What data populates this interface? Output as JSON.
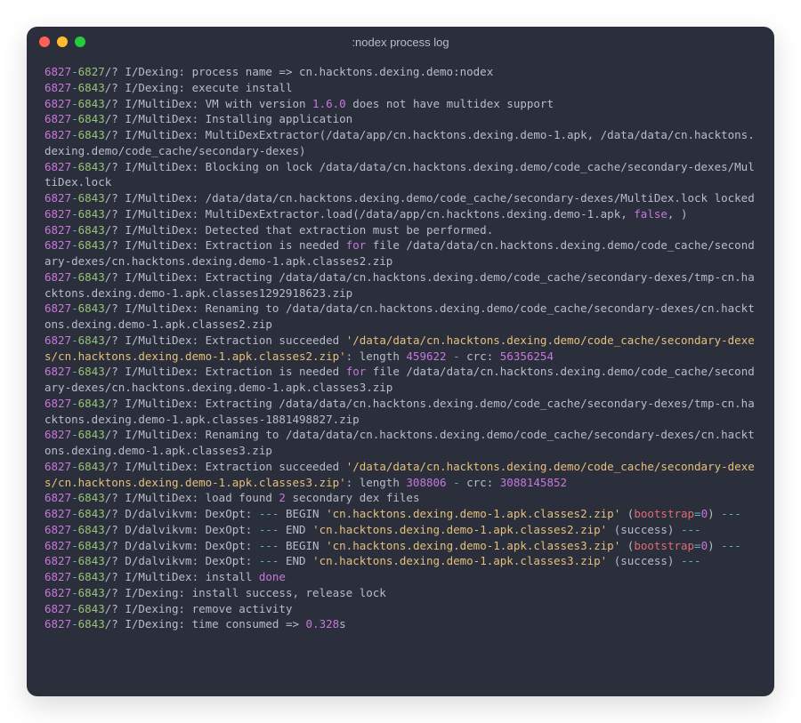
{
  "window": {
    "title": ":nodex process log"
  },
  "log": {
    "lines": [
      {
        "segments": [
          {
            "c": "magenta",
            "t": "6827"
          },
          {
            "c": "cyan",
            "t": "-"
          },
          {
            "c": "green",
            "t": "6827"
          },
          {
            "c": "gray",
            "t": "/? I/Dexing: process name => cn.hacktons.dexing.demo:nodex"
          }
        ]
      },
      {
        "segments": [
          {
            "c": "magenta",
            "t": "6827"
          },
          {
            "c": "cyan",
            "t": "-"
          },
          {
            "c": "green",
            "t": "6843"
          },
          {
            "c": "gray",
            "t": "/? I/Dexing: execute install"
          }
        ]
      },
      {
        "segments": [
          {
            "c": "magenta",
            "t": "6827"
          },
          {
            "c": "cyan",
            "t": "-"
          },
          {
            "c": "green",
            "t": "6843"
          },
          {
            "c": "gray",
            "t": "/? I/MultiDex: VM with version "
          },
          {
            "c": "magenta",
            "t": "1.6.0"
          },
          {
            "c": "gray",
            "t": " does not have multidex support"
          }
        ]
      },
      {
        "segments": [
          {
            "c": "magenta",
            "t": "6827"
          },
          {
            "c": "cyan",
            "t": "-"
          },
          {
            "c": "green",
            "t": "6843"
          },
          {
            "c": "gray",
            "t": "/? I/MultiDex: Installing application"
          }
        ]
      },
      {
        "segments": [
          {
            "c": "magenta",
            "t": "6827"
          },
          {
            "c": "cyan",
            "t": "-"
          },
          {
            "c": "green",
            "t": "6843"
          },
          {
            "c": "gray",
            "t": "/? I/MultiDex: MultiDexExtractor(/data/app/cn.hacktons.dexing.demo-1.apk, /data/data/cn.hacktons.dexing.demo/code_cache/secondary-dexes)"
          }
        ]
      },
      {
        "segments": [
          {
            "c": "magenta",
            "t": "6827"
          },
          {
            "c": "cyan",
            "t": "-"
          },
          {
            "c": "green",
            "t": "6843"
          },
          {
            "c": "gray",
            "t": "/? I/MultiDex: Blocking on lock /data/data/cn.hacktons.dexing.demo/code_cache/secondary-dexes/MultiDex.lock"
          }
        ]
      },
      {
        "segments": [
          {
            "c": "magenta",
            "t": "6827"
          },
          {
            "c": "cyan",
            "t": "-"
          },
          {
            "c": "green",
            "t": "6843"
          },
          {
            "c": "gray",
            "t": "/? I/MultiDex: /data/data/cn.hacktons.dexing.demo/code_cache/secondary-dexes/MultiDex.lock locked"
          }
        ]
      },
      {
        "segments": [
          {
            "c": "magenta",
            "t": "6827"
          },
          {
            "c": "cyan",
            "t": "-"
          },
          {
            "c": "green",
            "t": "6843"
          },
          {
            "c": "gray",
            "t": "/? I/MultiDex: MultiDexExtractor.load(/data/app/cn.hacktons.dexing.demo-1.apk, "
          },
          {
            "c": "magenta",
            "t": "false"
          },
          {
            "c": "gray",
            "t": ", )"
          }
        ]
      },
      {
        "segments": [
          {
            "c": "magenta",
            "t": "6827"
          },
          {
            "c": "cyan",
            "t": "-"
          },
          {
            "c": "green",
            "t": "6843"
          },
          {
            "c": "gray",
            "t": "/? I/MultiDex: Detected that extraction must be performed."
          }
        ]
      },
      {
        "segments": [
          {
            "c": "magenta",
            "t": "6827"
          },
          {
            "c": "cyan",
            "t": "-"
          },
          {
            "c": "green",
            "t": "6843"
          },
          {
            "c": "gray",
            "t": "/? I/MultiDex: Extraction is needed "
          },
          {
            "c": "magenta",
            "t": "for"
          },
          {
            "c": "gray",
            "t": " file /data/data/cn.hacktons.dexing.demo/code_cache/secondary-dexes/cn.hacktons.dexing.demo-1.apk.classes2.zip"
          }
        ]
      },
      {
        "segments": [
          {
            "c": "magenta",
            "t": "6827"
          },
          {
            "c": "cyan",
            "t": "-"
          },
          {
            "c": "green",
            "t": "6843"
          },
          {
            "c": "gray",
            "t": "/? I/MultiDex: Extracting /data/data/cn.hacktons.dexing.demo/code_cache/secondary-dexes/tmp-cn.hacktons.dexing.demo-1.apk.classes1292918623.zip"
          }
        ]
      },
      {
        "segments": [
          {
            "c": "magenta",
            "t": "6827"
          },
          {
            "c": "cyan",
            "t": "-"
          },
          {
            "c": "green",
            "t": "6843"
          },
          {
            "c": "gray",
            "t": "/? I/MultiDex: Renaming to /data/data/cn.hacktons.dexing.demo/code_cache/secondary-dexes/cn.hacktons.dexing.demo-1.apk.classes2.zip"
          }
        ]
      },
      {
        "segments": [
          {
            "c": "magenta",
            "t": "6827"
          },
          {
            "c": "cyan",
            "t": "-"
          },
          {
            "c": "green",
            "t": "6843"
          },
          {
            "c": "gray",
            "t": "/? I/MultiDex: Extraction succeeded "
          },
          {
            "c": "orange",
            "t": "'/data/data/cn.hacktons.dexing.demo/code_cache/secondary-dexes/cn.hacktons.dexing.demo-1.apk.classes2.zip'"
          },
          {
            "c": "gray",
            "t": ": length "
          },
          {
            "c": "magenta",
            "t": "459622"
          },
          {
            "c": "gray",
            "t": " "
          },
          {
            "c": "cyan",
            "t": "-"
          },
          {
            "c": "gray",
            "t": " crc: "
          },
          {
            "c": "magenta",
            "t": "56356254"
          }
        ]
      },
      {
        "segments": [
          {
            "c": "magenta",
            "t": "6827"
          },
          {
            "c": "cyan",
            "t": "-"
          },
          {
            "c": "green",
            "t": "6843"
          },
          {
            "c": "gray",
            "t": "/? I/MultiDex: Extraction is needed "
          },
          {
            "c": "magenta",
            "t": "for"
          },
          {
            "c": "gray",
            "t": " file /data/data/cn.hacktons.dexing.demo/code_cache/secondary-dexes/cn.hacktons.dexing.demo-1.apk.classes3.zip"
          }
        ]
      },
      {
        "segments": [
          {
            "c": "magenta",
            "t": "6827"
          },
          {
            "c": "cyan",
            "t": "-"
          },
          {
            "c": "green",
            "t": "6843"
          },
          {
            "c": "gray",
            "t": "/? I/MultiDex: Extracting /data/data/cn.hacktons.dexing.demo/code_cache/secondary-dexes/tmp-cn.hacktons.dexing.demo-1.apk.classes-1881498827.zip"
          }
        ]
      },
      {
        "segments": [
          {
            "c": "magenta",
            "t": "6827"
          },
          {
            "c": "cyan",
            "t": "-"
          },
          {
            "c": "green",
            "t": "6843"
          },
          {
            "c": "gray",
            "t": "/? I/MultiDex: Renaming to /data/data/cn.hacktons.dexing.demo/code_cache/secondary-dexes/cn.hacktons.dexing.demo-1.apk.classes3.zip"
          }
        ]
      },
      {
        "segments": [
          {
            "c": "magenta",
            "t": "6827"
          },
          {
            "c": "cyan",
            "t": "-"
          },
          {
            "c": "green",
            "t": "6843"
          },
          {
            "c": "gray",
            "t": "/? I/MultiDex: Extraction succeeded "
          },
          {
            "c": "orange",
            "t": "'/data/data/cn.hacktons.dexing.demo/code_cache/secondary-dexes/cn.hacktons.dexing.demo-1.apk.classes3.zip'"
          },
          {
            "c": "gray",
            "t": ": length "
          },
          {
            "c": "magenta",
            "t": "308806"
          },
          {
            "c": "gray",
            "t": " "
          },
          {
            "c": "cyan",
            "t": "-"
          },
          {
            "c": "gray",
            "t": " crc: "
          },
          {
            "c": "magenta",
            "t": "3088145852"
          }
        ]
      },
      {
        "segments": [
          {
            "c": "magenta",
            "t": "6827"
          },
          {
            "c": "cyan",
            "t": "-"
          },
          {
            "c": "green",
            "t": "6843"
          },
          {
            "c": "gray",
            "t": "/? I/MultiDex: load found "
          },
          {
            "c": "magenta",
            "t": "2"
          },
          {
            "c": "gray",
            "t": " secondary dex files"
          }
        ]
      },
      {
        "segments": [
          {
            "c": "magenta",
            "t": "6827"
          },
          {
            "c": "cyan",
            "t": "-"
          },
          {
            "c": "green",
            "t": "6843"
          },
          {
            "c": "gray",
            "t": "/? D/dalvikvm: DexOpt: "
          },
          {
            "c": "cyan",
            "t": "---"
          },
          {
            "c": "gray",
            "t": " BEGIN "
          },
          {
            "c": "orange",
            "t": "'cn.hacktons.dexing.demo-1.apk.classes2.zip'"
          },
          {
            "c": "gray",
            "t": " ("
          },
          {
            "c": "red",
            "t": "bootstrap"
          },
          {
            "c": "cyan",
            "t": "="
          },
          {
            "c": "magenta",
            "t": "0"
          },
          {
            "c": "gray",
            "t": ") "
          },
          {
            "c": "cyan",
            "t": "---"
          }
        ]
      },
      {
        "segments": [
          {
            "c": "magenta",
            "t": "6827"
          },
          {
            "c": "cyan",
            "t": "-"
          },
          {
            "c": "green",
            "t": "6843"
          },
          {
            "c": "gray",
            "t": "/? D/dalvikvm: DexOpt: "
          },
          {
            "c": "cyan",
            "t": "---"
          },
          {
            "c": "gray",
            "t": " END "
          },
          {
            "c": "orange",
            "t": "'cn.hacktons.dexing.demo-1.apk.classes2.zip'"
          },
          {
            "c": "gray",
            "t": " (success) "
          },
          {
            "c": "cyan",
            "t": "---"
          }
        ]
      },
      {
        "segments": [
          {
            "c": "magenta",
            "t": "6827"
          },
          {
            "c": "cyan",
            "t": "-"
          },
          {
            "c": "green",
            "t": "6843"
          },
          {
            "c": "gray",
            "t": "/? D/dalvikvm: DexOpt: "
          },
          {
            "c": "cyan",
            "t": "---"
          },
          {
            "c": "gray",
            "t": " BEGIN "
          },
          {
            "c": "orange",
            "t": "'cn.hacktons.dexing.demo-1.apk.classes3.zip'"
          },
          {
            "c": "gray",
            "t": " ("
          },
          {
            "c": "red",
            "t": "bootstrap"
          },
          {
            "c": "cyan",
            "t": "="
          },
          {
            "c": "magenta",
            "t": "0"
          },
          {
            "c": "gray",
            "t": ") "
          },
          {
            "c": "cyan",
            "t": "---"
          }
        ]
      },
      {
        "segments": [
          {
            "c": "magenta",
            "t": "6827"
          },
          {
            "c": "cyan",
            "t": "-"
          },
          {
            "c": "green",
            "t": "6843"
          },
          {
            "c": "gray",
            "t": "/? D/dalvikvm: DexOpt: "
          },
          {
            "c": "cyan",
            "t": "---"
          },
          {
            "c": "gray",
            "t": " END "
          },
          {
            "c": "orange",
            "t": "'cn.hacktons.dexing.demo-1.apk.classes3.zip'"
          },
          {
            "c": "gray",
            "t": " (success) "
          },
          {
            "c": "cyan",
            "t": "---"
          }
        ]
      },
      {
        "segments": [
          {
            "c": "magenta",
            "t": "6827"
          },
          {
            "c": "cyan",
            "t": "-"
          },
          {
            "c": "green",
            "t": "6843"
          },
          {
            "c": "gray",
            "t": "/? I/MultiDex: install "
          },
          {
            "c": "magenta",
            "t": "done"
          }
        ]
      },
      {
        "segments": [
          {
            "c": "magenta",
            "t": "6827"
          },
          {
            "c": "cyan",
            "t": "-"
          },
          {
            "c": "green",
            "t": "6843"
          },
          {
            "c": "gray",
            "t": "/? I/Dexing: install success, release lock"
          }
        ]
      },
      {
        "segments": [
          {
            "c": "magenta",
            "t": "6827"
          },
          {
            "c": "cyan",
            "t": "-"
          },
          {
            "c": "green",
            "t": "6843"
          },
          {
            "c": "gray",
            "t": "/? I/Dexing: remove activity"
          }
        ]
      },
      {
        "segments": [
          {
            "c": "magenta",
            "t": "6827"
          },
          {
            "c": "cyan",
            "t": "-"
          },
          {
            "c": "green",
            "t": "6843"
          },
          {
            "c": "gray",
            "t": "/? I/Dexing: time consumed => "
          },
          {
            "c": "magenta",
            "t": "0.328"
          },
          {
            "c": "gray",
            "t": "s"
          }
        ]
      }
    ]
  }
}
